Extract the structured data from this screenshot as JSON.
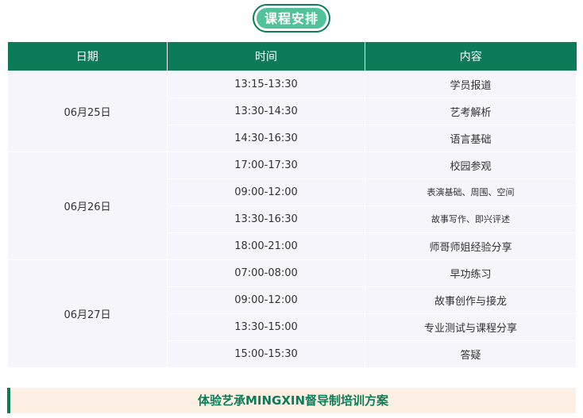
{
  "section_title": "课程安排",
  "table": {
    "headers": [
      "日期",
      "时间",
      "内容"
    ],
    "groups": [
      {
        "date": "06月25日",
        "rows": [
          {
            "time": "13:15-13:30",
            "content": "学员报道"
          },
          {
            "time": "13:30-14:30",
            "content": "艺考解析"
          },
          {
            "time": "14:30-16:30",
            "content": "语言基础"
          }
        ]
      },
      {
        "date": "06月26日",
        "rows": [
          {
            "time": "17:00-17:30",
            "content": "校园参观"
          },
          {
            "time": "09:00-12:00",
            "content": "表演基础、周围、空间"
          },
          {
            "time": "13:30-16:30",
            "content": "故事写作、即兴评述"
          },
          {
            "time": "18:00-21:00",
            "content": "师哥师姐经验分享"
          }
        ]
      },
      {
        "date": "06月27日",
        "rows": [
          {
            "time": "07:00-08:00",
            "content": "早功练习"
          },
          {
            "time": "09:00-12:00",
            "content": "故事创作与接龙"
          },
          {
            "time": "13:30-15:00",
            "content": "专业测试与课程分享"
          },
          {
            "time": "15:00-15:30",
            "content": "答疑"
          }
        ]
      }
    ]
  },
  "bottom_banner": "体验艺承MINGXIN督导制培训方案",
  "colors": {
    "accent": "#0b7c57",
    "pill": "#52c29a",
    "cell_bg": "#f5f5fb",
    "banner_bg": "#fcf0e4"
  }
}
